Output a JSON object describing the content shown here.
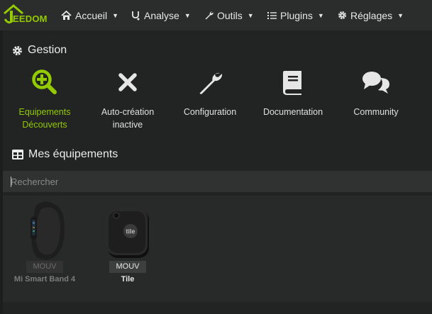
{
  "navbar": {
    "logo_text": "EEDOM",
    "items": [
      {
        "label": "Accueil",
        "icon": "home-icon"
      },
      {
        "label": "Analyse",
        "icon": "stethoscope-icon"
      },
      {
        "label": "Outils",
        "icon": "wrench-icon"
      },
      {
        "label": "Plugins",
        "icon": "list-icon"
      },
      {
        "label": "Réglages",
        "icon": "gear-icon"
      }
    ]
  },
  "gestion": {
    "title": "Gestion",
    "items": [
      {
        "line1": "Equipements",
        "line2": "Découverts",
        "icon": "search-plus-icon",
        "active": true
      },
      {
        "line1": "Auto-création",
        "line2": "inactive",
        "icon": "close-icon",
        "active": false
      },
      {
        "line1": "Configuration",
        "line2": "",
        "icon": "wrench-icon",
        "active": false
      },
      {
        "line1": "Documentation",
        "line2": "",
        "icon": "book-icon",
        "active": false
      },
      {
        "line1": "Community",
        "line2": "",
        "icon": "comments-icon",
        "active": false
      }
    ]
  },
  "equipements": {
    "title": "Mes équipements",
    "search_placeholder": "Rechercher",
    "items": [
      {
        "name": "Mi Smart Band 4",
        "badge": "MOUV",
        "enabled": false,
        "image": "fitness-band"
      },
      {
        "name": "Tile",
        "badge": "MOUV",
        "enabled": true,
        "image": "tile-tracker"
      }
    ]
  },
  "colors": {
    "accent": "#93ca02",
    "navbar_bg": "#2b2c2c",
    "body_bg": "#1c1d1d"
  }
}
